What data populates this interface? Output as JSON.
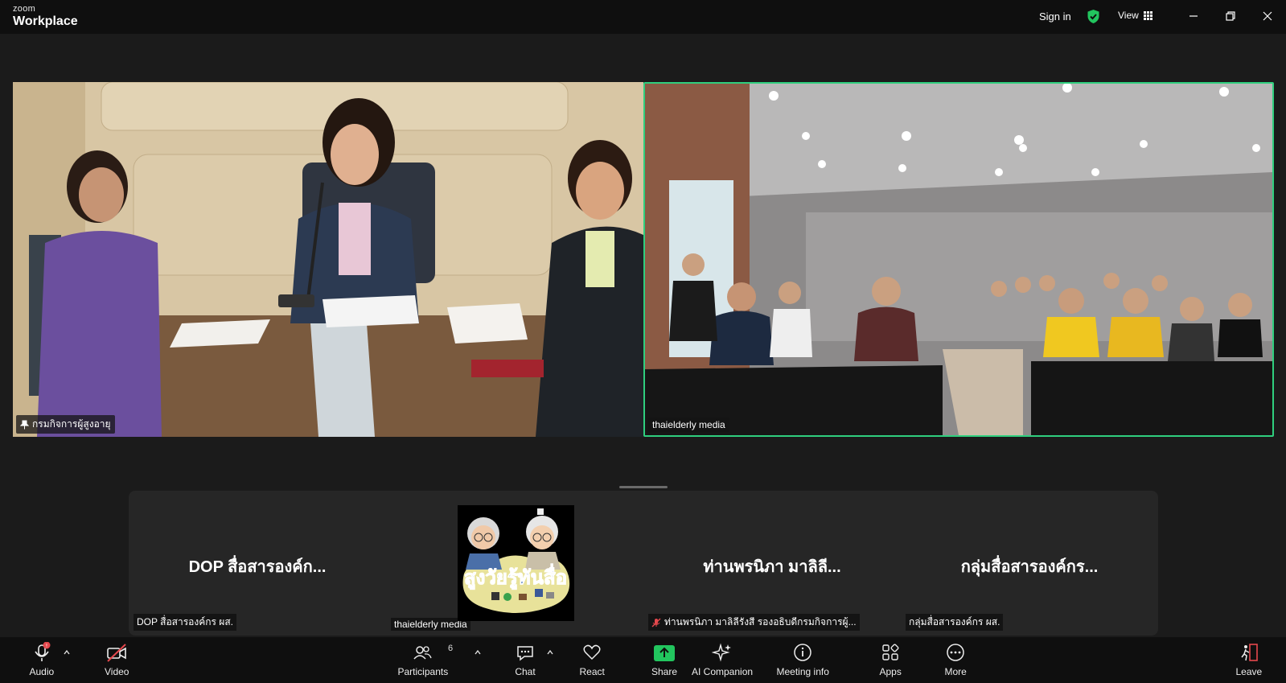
{
  "app": {
    "brand_small": "zoom",
    "brand_name": "Workplace"
  },
  "titlebar": {
    "signin": "Sign in",
    "view": "View"
  },
  "videos": {
    "left": {
      "name": "กรมกิจการผู้สูงอายุ",
      "pinned": true
    },
    "right": {
      "name": "thaielderly media",
      "active_speaker": true
    }
  },
  "strip": {
    "tiles": [
      {
        "big_label": "DOP สื่อสารองค์ก...",
        "name": "DOP สื่อสารองค์กร ผส."
      },
      {
        "logo_text": "สูงวัยรู้ทันสื่อ",
        "name": "thaielderly media"
      },
      {
        "big_label": "ท่านพรนิภา มาลิลี...",
        "name": "ท่านพรนิภา มาลิลีรังสี รองอธิบดีกรมกิจการผู้...",
        "muted": true
      },
      {
        "big_label": "กลุ่มสื่อสารองค์กร...",
        "name": "กลุ่มสื่อสารองค์กร ผส."
      }
    ]
  },
  "toolbar": {
    "audio": "Audio",
    "video": "Video",
    "participants": "Participants",
    "participants_count": "6",
    "chat": "Chat",
    "react": "React",
    "share": "Share",
    "ai_companion": "AI Companion",
    "meeting_info": "Meeting info",
    "apps": "Apps",
    "more": "More",
    "leave": "Leave"
  },
  "colors": {
    "active_speaker": "#2fcf7e",
    "share": "#22c55e",
    "leave": "#e5484d",
    "shield": "#22c55e"
  }
}
